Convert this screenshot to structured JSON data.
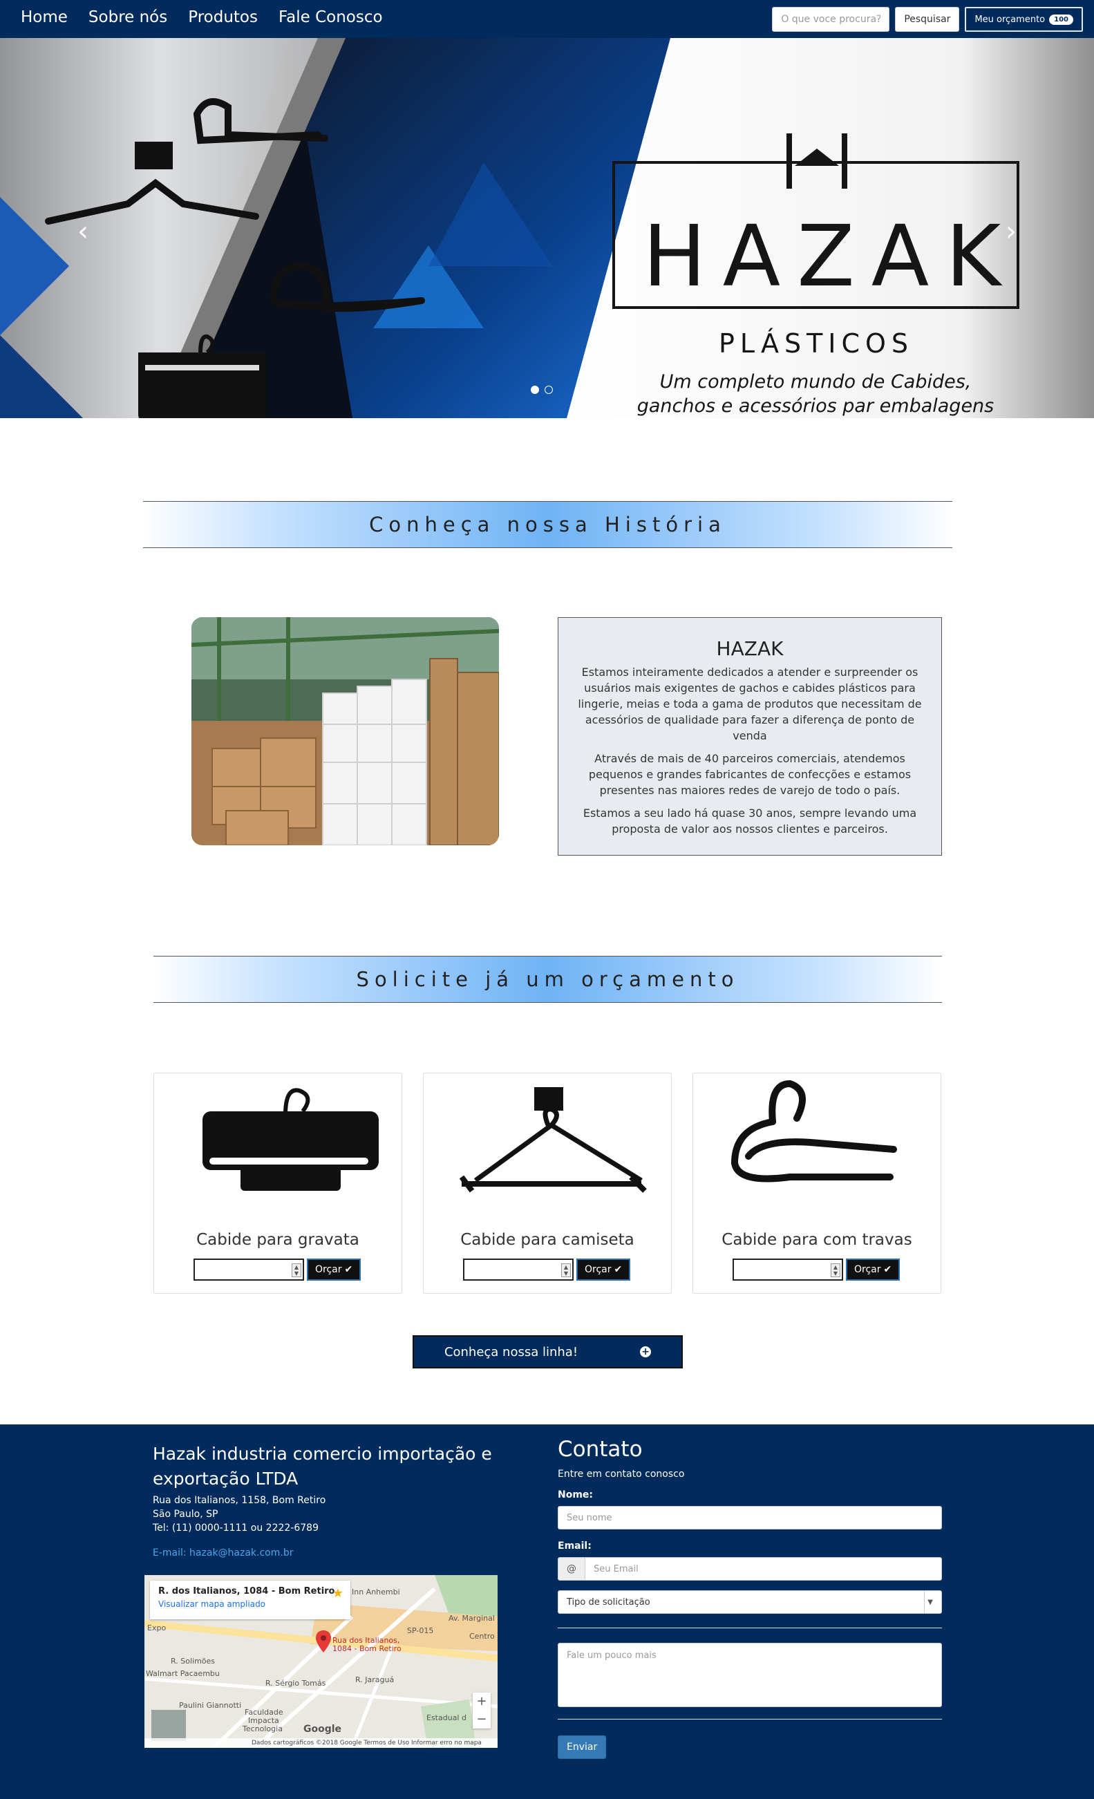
{
  "nav": {
    "links": [
      "Home",
      "Sobre nós",
      "Produtos",
      "Fale Conosco"
    ],
    "search_placeholder": "O que voce procura?",
    "search_button": "Pesquisar",
    "cart_label": "Meu orçamento",
    "cart_count": "100"
  },
  "hero": {
    "brand": "HAZAK",
    "brand_sub": "PLÁSTICOS",
    "tagline_line1": "Um completo mundo de Cabides,",
    "tagline_line2": "ganchos e acessórios par embalagens",
    "prev_glyph": "‹",
    "next_glyph": "›",
    "active_slide": 1,
    "slide_count": 2
  },
  "history": {
    "heading": "Conheça nossa História",
    "about_title": "HAZAK",
    "paragraphs": [
      "Estamos inteiramente dedicados a atender e surpreender os usuários mais exigentes de gachos e cabides plásticos para lingerie, meias e toda a gama de produtos que necessitam de acessórios de qualidade para fazer a diferença de ponto de venda",
      "Através de mais de 40 parceiros comerciais, atendemos pequenos e grandes fabricantes de confecções e estamos presentes nas maiores redes de varejo de todo o país.",
      "Estamos a seu lado há quase 30 anos, sempre levando uma proposta de valor aos nossos clientes e parceiros."
    ]
  },
  "quote": {
    "heading": "Solicite já um orçamento",
    "products": [
      {
        "title": "Cabide para gravata",
        "button": "Orçar",
        "icon": "tie-hanger-icon"
      },
      {
        "title": "Cabide para camiseta",
        "button": "Orçar",
        "icon": "shirt-hanger-icon"
      },
      {
        "title": "Cabide para com travas",
        "button": "Orçar",
        "icon": "lock-hanger-icon"
      }
    ],
    "line_button": "Conheça nossa linha!",
    "line_icon": "plus-circle-icon"
  },
  "footer": {
    "company_name": "Hazak industria comercio importação e exportação LTDA",
    "address_line1": "Rua dos Italianos, 1158, Bom Retiro",
    "address_line2": "São Paulo, SP",
    "phone": "Tel: (11) 0000-1111 ou 2222-6789",
    "email": "E-mail: hazak@hazak.com.br",
    "map": {
      "card_title": "R. dos Italianos, 1084 - Bom Retiro",
      "card_link": "Visualizar mapa ampliado",
      "pin_label_1": "Rua dos Italianos,",
      "pin_label_2": "1084 - Bom Retiro",
      "labels": [
        "Inn Anhembi",
        "Av. Marginal",
        "Expo",
        "R. Solimões",
        "Walmart Pacaembu",
        "R. Sérgio Tomás",
        "R. Jaraguá",
        "Faculdade",
        "Impacta",
        "Tecnologia",
        "Centro",
        "Estadual d",
        "SP-015",
        "Paulini Giannotti"
      ],
      "footer_text": "Dados cartográficos ©2018 Google   Termos de Uso   Informar erro no mapa",
      "google": "Google"
    },
    "contact": {
      "title": "Contato",
      "subtitle": "Entre em contato conosco",
      "name_label": "Nome:",
      "name_placeholder": "Seu nome",
      "email_label": "Email:",
      "email_addon": "@",
      "email_placeholder": "Seu Email",
      "request_type": "Tipo de solicitação",
      "message_placeholder": "Fale um pouco mais",
      "submit": "Enviar"
    }
  },
  "colors": {
    "navy": "#002b5c",
    "accent_blue": "#337ab7",
    "link_blue": "#4da3e8"
  }
}
